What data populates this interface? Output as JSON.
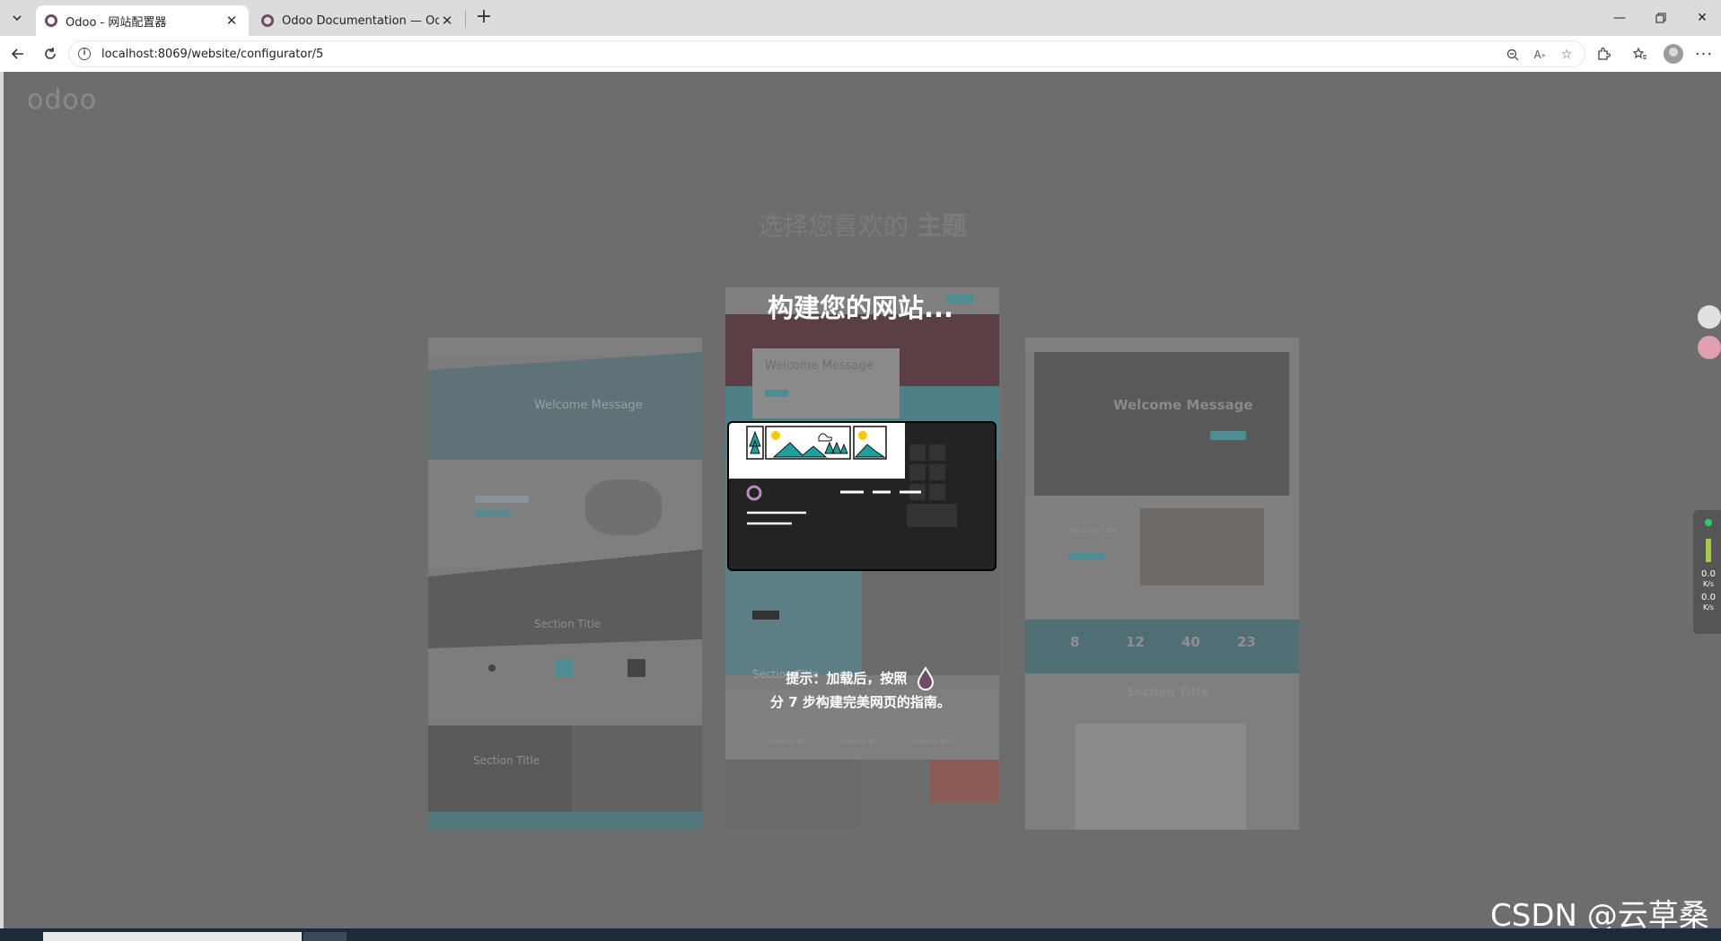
{
  "browser": {
    "tabs": [
      {
        "title": "Odoo - 网站配置器",
        "active": true
      },
      {
        "title": "Odoo Documentation — Odoo 16",
        "active": false
      }
    ],
    "url": "localhost:8069/website/configurator/5"
  },
  "page": {
    "logo": "odoo",
    "heading_normal": "选择您喜欢的",
    "heading_bold": "主题",
    "loading_title": "构建您的网站...",
    "hint_line1": "提示：加载后，按照",
    "hint_line2": "分 7 步构建完美网页的指南。"
  },
  "themes": {
    "left": {
      "welcome": "Welcome Message",
      "section": "Section Title",
      "section2": "Section Title"
    },
    "mid": {
      "welcome": "Welcome Message",
      "section": "Section Title",
      "features": [
        "Feature #01",
        "Feature #02",
        "Feature #03"
      ]
    },
    "right": {
      "welcome": "Welcome Message",
      "section": "Section Title",
      "stats": [
        "8",
        "12",
        "40",
        "23"
      ],
      "section2": "Section Title"
    }
  },
  "network": {
    "up": "0.0",
    "up_unit": "K/s",
    "down": "0.0",
    "down_unit": "K/s"
  },
  "watermark": "CSDN @云草桑",
  "colors": {
    "odoo_purple": "#714b67",
    "teal": "#1f9e9e",
    "sun": "#f5c800"
  }
}
